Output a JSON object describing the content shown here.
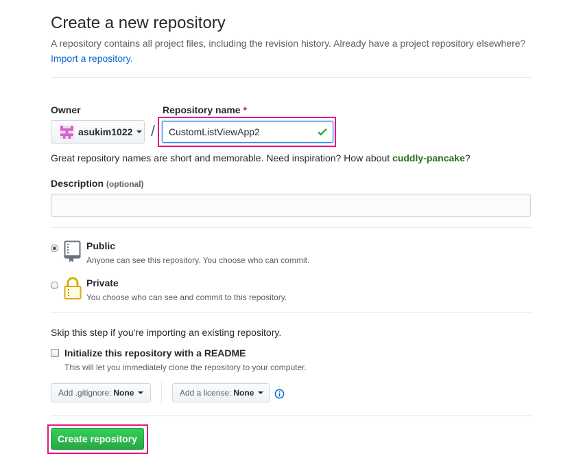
{
  "header": {
    "title": "Create a new repository",
    "lead": "A repository contains all project files, including the revision history. Already have a project repository elsewhere?",
    "import_link": "Import a repository",
    "import_suffix": "."
  },
  "owner": {
    "label": "Owner",
    "value": "asukim1022"
  },
  "repo_name": {
    "label": "Repository name",
    "required_mark": "*",
    "value": "CustomListViewApp2",
    "separator": "/"
  },
  "hint": {
    "text": "Great repository names are short and memorable. Need inspiration? How about ",
    "suggestion": "cuddly-pancake",
    "suffix": "?"
  },
  "description": {
    "label": "Description",
    "optional": "(optional)",
    "value": ""
  },
  "visibility": {
    "public": {
      "title": "Public",
      "note": "Anyone can see this repository. You choose who can commit.",
      "checked": true
    },
    "private": {
      "title": "Private",
      "note": "You choose who can see and commit to this repository.",
      "checked": false
    }
  },
  "init": {
    "skip_text": "Skip this step if you're importing an existing repository.",
    "readme_label": "Initialize this repository with a README",
    "readme_note": "This will let you immediately clone the repository to your computer.",
    "readme_checked": false
  },
  "gitignore": {
    "label": "Add .gitignore:",
    "value": "None"
  },
  "license": {
    "label": "Add a license:",
    "value": "None"
  },
  "submit": {
    "label": "Create repository"
  },
  "colors": {
    "accent_highlight": "#e8127f",
    "create_button": "#28a745",
    "link": "#0366d6",
    "suggestion": "#2c6a22",
    "check": "#28a745"
  },
  "icons": {
    "owner_avatar": "identicon-avatar",
    "valid": "check-icon",
    "public": "repo-book-icon",
    "private": "lock-icon",
    "info": "info-icon"
  }
}
